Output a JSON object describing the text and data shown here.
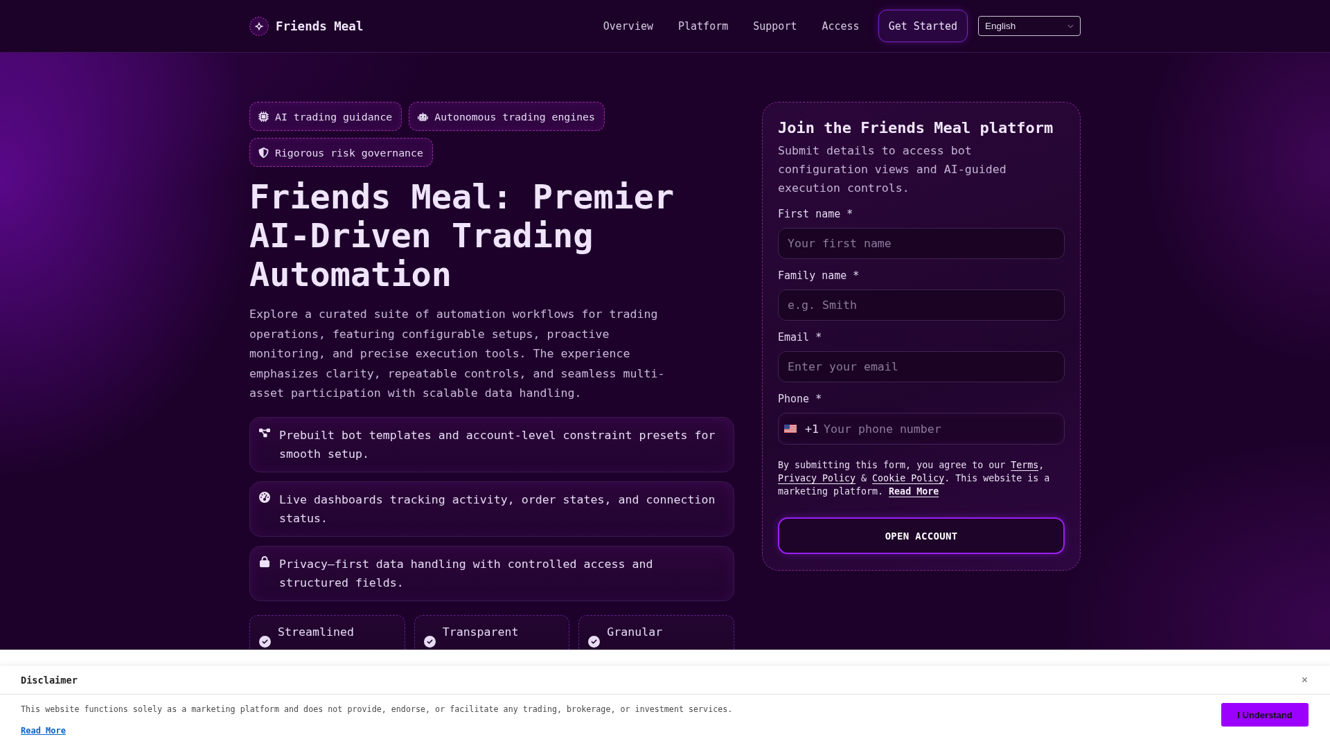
{
  "header": {
    "brand": "Friends Meal",
    "nav": [
      {
        "label": "Overview"
      },
      {
        "label": "Platform"
      },
      {
        "label": "Support"
      },
      {
        "label": "Access"
      }
    ],
    "cta": "Get Started",
    "language": "English"
  },
  "hero": {
    "tags": [
      {
        "label": "AI trading guidance"
      },
      {
        "label": "Autonomous trading engines"
      },
      {
        "label": "Rigorous risk governance"
      }
    ],
    "title": "Friends Meal: Premier AI-Driven Trading Automation",
    "intro": "Explore a curated suite of automation workflows for trading operations, featuring configurable setups, proactive monitoring, and precise execution tools. The experience emphasizes clarity, repeatable controls, and seamless multi-asset participation with scalable data handling.",
    "features": [
      {
        "text": "Prebuilt bot templates and account-level constraint presets for smooth setup."
      },
      {
        "text": "Live dashboards tracking activity, order states, and connection status."
      },
      {
        "text": "Privacy–first data handling with controlled access and structured fields."
      }
    ],
    "highlights": [
      {
        "label": "Streamlined"
      },
      {
        "label": "Transparent"
      },
      {
        "label": "Granular"
      }
    ]
  },
  "signup_form": {
    "title": "Join the Friends Meal platform",
    "subtitle": "Submit details to access bot configuration views and AI-guided execution controls.",
    "fields": [
      {
        "kind": "text",
        "label": "First name *",
        "placeholder": "Your first name"
      },
      {
        "kind": "text",
        "label": "Family name *",
        "placeholder": "e.g. Smith"
      },
      {
        "kind": "email",
        "label": "Email *",
        "placeholder": "Enter your email"
      },
      {
        "kind": "phone",
        "label": "Phone *",
        "dial_code": "+1",
        "placeholder": "Your phone number"
      }
    ],
    "consent": [
      {
        "kind": "text",
        "text": "By submitting this form, you agree to our "
      },
      {
        "kind": "link",
        "text": "Terms"
      },
      {
        "kind": "text",
        "text": ", "
      },
      {
        "kind": "link",
        "text": "Privacy Policy"
      },
      {
        "kind": "text",
        "text": " & "
      },
      {
        "kind": "link",
        "text": "Cookie Policy"
      },
      {
        "kind": "text",
        "text": ". This website is a marketing platform. "
      },
      {
        "kind": "strong_link",
        "text": "Read More"
      }
    ],
    "submit": "OPEN ACCOUNT"
  },
  "disclaimer": {
    "title": "Disclaimer",
    "text": "This website functions solely as a marketing platform and does not provide, endorse, or facilitate any trading, brokerage, or investment services.",
    "link": "Read More",
    "button": "I Understand"
  }
}
